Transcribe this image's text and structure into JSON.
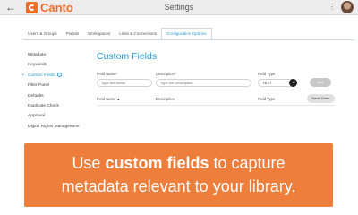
{
  "header": {
    "back_icon": "left-arrow-icon",
    "brand": "Canto",
    "title": "Settings",
    "menu_glyph": "⋮"
  },
  "tabs": [
    {
      "label": "Users & Groups",
      "active": false
    },
    {
      "label": "Portals",
      "active": false
    },
    {
      "label": "Workspaces",
      "active": false
    },
    {
      "label": "Links & Connections",
      "active": false
    },
    {
      "label": "Configuration Options",
      "active": true
    }
  ],
  "sidebar": {
    "items": [
      {
        "label": "Metadata"
      },
      {
        "label": "Keywords"
      },
      {
        "label": "Custom Fields",
        "active": true
      },
      {
        "label": "Filter Panel"
      },
      {
        "label": "Defaults"
      },
      {
        "label": "Duplicate Check"
      },
      {
        "label": "Approval"
      },
      {
        "label": "Digital Rights Management"
      }
    ],
    "active_bullet": "•"
  },
  "main": {
    "title": "Custom Fields",
    "form": {
      "field_name_label": "Field Name*",
      "field_name_placeholder": "Type the Name.",
      "description_label": "Description*",
      "description_placeholder": "Type the Description.",
      "field_type_label": "Field Type",
      "field_type_value": "TEXT",
      "add_button": "Add"
    },
    "table": {
      "col_name": "Field Name",
      "sort_glyph": "▲",
      "col_description": "Description",
      "col_type": "Field Type",
      "save_order_button": "Save Order"
    }
  },
  "caption": {
    "line1_pre": "Use ",
    "line1_bold": "custom fields",
    "line1_post": " to capture",
    "line2": "metadata relevant to your library."
  },
  "colors": {
    "accent": "#2a9bd1",
    "brand": "#f06d2a",
    "banner": "#ed7a35"
  }
}
